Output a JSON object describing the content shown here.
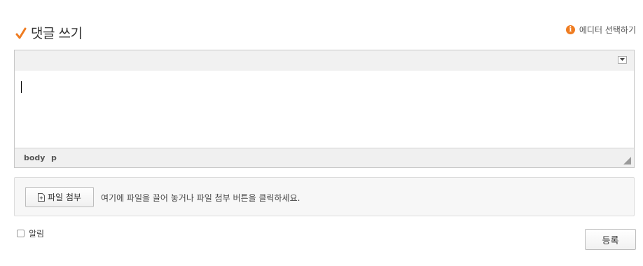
{
  "header": {
    "title": "댓글 쓰기",
    "editor_select_label": "에디터 선택하기",
    "info_icon": "i"
  },
  "editor": {
    "path": [
      "body",
      "p"
    ]
  },
  "attach": {
    "button_label": "파일 첨부",
    "hint": "여기에 파일을 끌어 놓거나 파일 첨부 버튼을 클릭하세요."
  },
  "footer": {
    "notify_label": "알림",
    "submit_label": "등록"
  },
  "colors": {
    "accent": "#ef7c21",
    "toolbar_bg": "#f1f1f1",
    "attach_bg": "#f7f7f7"
  }
}
